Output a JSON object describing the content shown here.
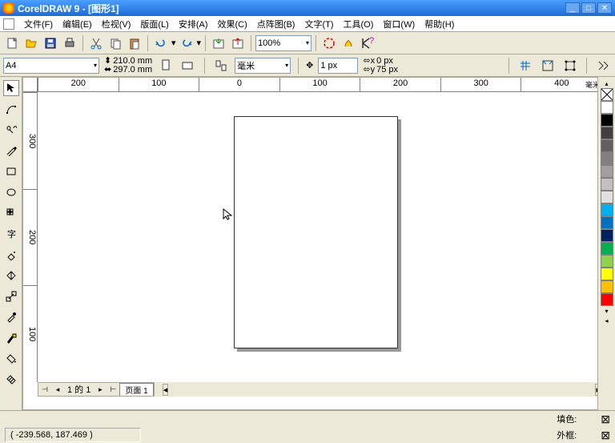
{
  "title": "CorelDRAW 9 - [图形1]",
  "window": {
    "min": "_",
    "max": "□",
    "close": "✕"
  },
  "menu": [
    "文件(F)",
    "编辑(E)",
    "检视(V)",
    "版面(L)",
    "安排(A)",
    "效果(C)",
    "点阵图(B)",
    "文字(T)",
    "工具(O)",
    "窗口(W)",
    "帮助(H)"
  ],
  "toolbar1": {
    "zoom": "100%"
  },
  "prop": {
    "paper": "A4",
    "w": "210.0 mm",
    "h": "297.0 mm",
    "units": "毫米",
    "nudge": "1 px",
    "dx": "0 px",
    "dy": "75 px"
  },
  "ruler": {
    "h": [
      "200",
      "100",
      "0",
      "100",
      "200",
      "300",
      "400"
    ],
    "unit": "毫米",
    "v": [
      "300",
      "200",
      "100"
    ]
  },
  "nav": {
    "pages": "1 的 1",
    "tab": "页面   1"
  },
  "status": {
    "coords": "( -239.568, 187.469 )",
    "fill": "填色:",
    "outline": "外框:"
  },
  "palette": [
    "#ffffff",
    "#000000",
    "#404040",
    "#606060",
    "#808080",
    "#a0a0a0",
    "#c0c0c0",
    "#e0e0e0",
    "#00b0f0",
    "#0070c0",
    "#002060",
    "#00b050",
    "#92d050",
    "#ffff00",
    "#ffc000",
    "#ff0000",
    "#c00000"
  ]
}
